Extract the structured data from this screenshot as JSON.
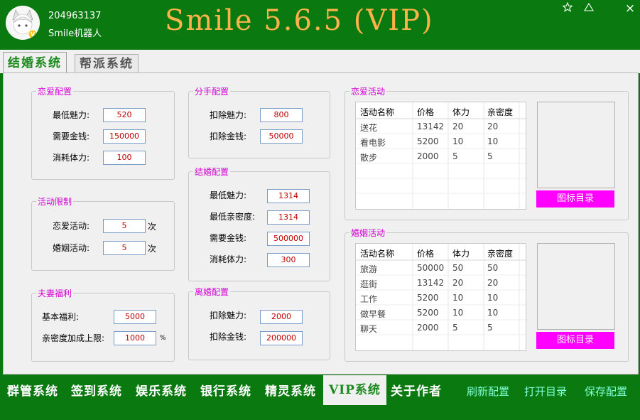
{
  "header": {
    "user_id": "204963137",
    "user_name": "Smile机器人",
    "title": "Smile 5.6.5 (VIP)",
    "pin_icon": "star-icon",
    "collapse_icon": "triangle-icon",
    "close_label": "×"
  },
  "tabs": [
    {
      "label": "结婚系统"
    },
    {
      "label": "帮派系统"
    }
  ],
  "love_config": {
    "title": "恋爱配置",
    "rows": [
      {
        "label": "最低魅力:",
        "value": "520"
      },
      {
        "label": "需要金钱:",
        "value": "150000"
      },
      {
        "label": "消耗体力:",
        "value": "100"
      }
    ]
  },
  "activity_limit": {
    "title": "活动限制",
    "rows": [
      {
        "label": "恋爱活动:",
        "value": "5",
        "unit": "次"
      },
      {
        "label": "婚姻活动:",
        "value": "5",
        "unit": "次"
      }
    ]
  },
  "couple_welfare": {
    "title": "夫妻福利",
    "rows": [
      {
        "label": "基本福利:",
        "value": "5000",
        "unit": ""
      },
      {
        "label": "亲密度加成上限:",
        "value": "1000",
        "unit": "%"
      }
    ]
  },
  "breakup_config": {
    "title": "分手配置",
    "rows": [
      {
        "label": "扣除魅力:",
        "value": "800"
      },
      {
        "label": "扣除金钱:",
        "value": "50000"
      }
    ]
  },
  "marriage_config": {
    "title": "结婚配置",
    "rows": [
      {
        "label": "最低魅力:",
        "value": "1314"
      },
      {
        "label": "最低亲密度:",
        "value": "1314"
      },
      {
        "label": "需要金钱:",
        "value": "500000"
      },
      {
        "label": "消耗体力:",
        "value": "300"
      }
    ]
  },
  "divorce_config": {
    "title": "离婚配置",
    "rows": [
      {
        "label": "扣除魅力:",
        "value": "2000"
      },
      {
        "label": "扣除金钱:",
        "value": "200000"
      }
    ]
  },
  "love_activities": {
    "title": "恋爱活动",
    "columns": [
      "活动名称",
      "价格",
      "体力",
      "亲密度"
    ],
    "rows": [
      [
        "送花",
        "13142",
        "20",
        "20"
      ],
      [
        "看电影",
        "5200",
        "10",
        "10"
      ],
      [
        "散步",
        "2000",
        "5",
        "5"
      ]
    ],
    "button": "图标目录"
  },
  "marriage_activities": {
    "title": "婚姻活动",
    "columns": [
      "活动名称",
      "价格",
      "体力",
      "亲密度"
    ],
    "rows": [
      [
        "旅游",
        "50000",
        "50",
        "50"
      ],
      [
        "逛街",
        "13142",
        "20",
        "20"
      ],
      [
        "工作",
        "5200",
        "10",
        "10"
      ],
      [
        "做早餐",
        "5200",
        "10",
        "10"
      ],
      [
        "聊天",
        "2000",
        "5",
        "5"
      ]
    ],
    "button": "图标目录"
  },
  "bottom_nav": [
    {
      "label": "群管系统"
    },
    {
      "label": "签到系统"
    },
    {
      "label": "娱乐系统"
    },
    {
      "label": "银行系统"
    },
    {
      "label": "精灵系统"
    },
    {
      "label": "VIP系统"
    },
    {
      "label": "关于作者"
    }
  ],
  "bottom_actions": [
    {
      "label": "刷新配置"
    },
    {
      "label": "打开目录"
    },
    {
      "label": "保存配置"
    }
  ]
}
